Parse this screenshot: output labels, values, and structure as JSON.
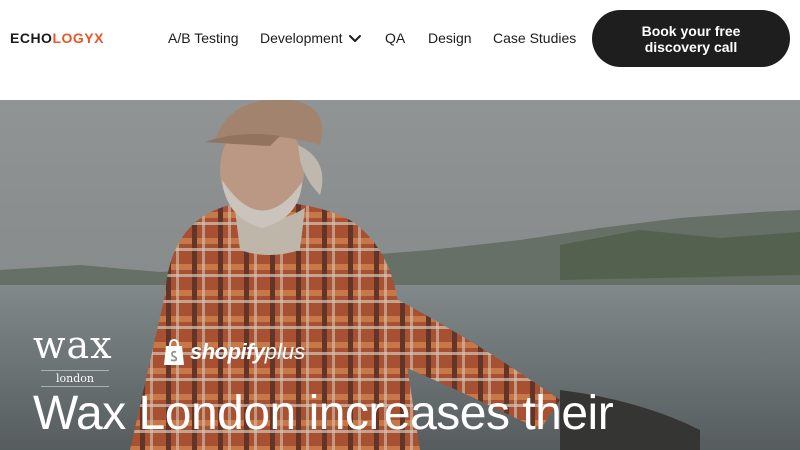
{
  "header": {
    "logo": {
      "part1": "ECHO",
      "part2": "LOGYX"
    },
    "nav": [
      {
        "label": "A/B Testing"
      },
      {
        "label": "Development",
        "has_dropdown": true
      },
      {
        "label": "QA"
      },
      {
        "label": "Design"
      },
      {
        "label": "Case Studies"
      }
    ],
    "cta_label": "Book your free discovery call"
  },
  "hero": {
    "brand_wax": {
      "name": "wax",
      "sub": "london"
    },
    "brand_shopify": {
      "name": "shopify",
      "plus": "plus"
    },
    "headline": "Wax London increases their"
  },
  "colors": {
    "logo_accent": "#e8562a",
    "cta_bg": "#1e1e1e",
    "text_dark": "#1c1c1c"
  },
  "icons": {
    "development_dropdown": "chevron-down-icon",
    "shopify_logo": "shopping-bag-icon"
  }
}
